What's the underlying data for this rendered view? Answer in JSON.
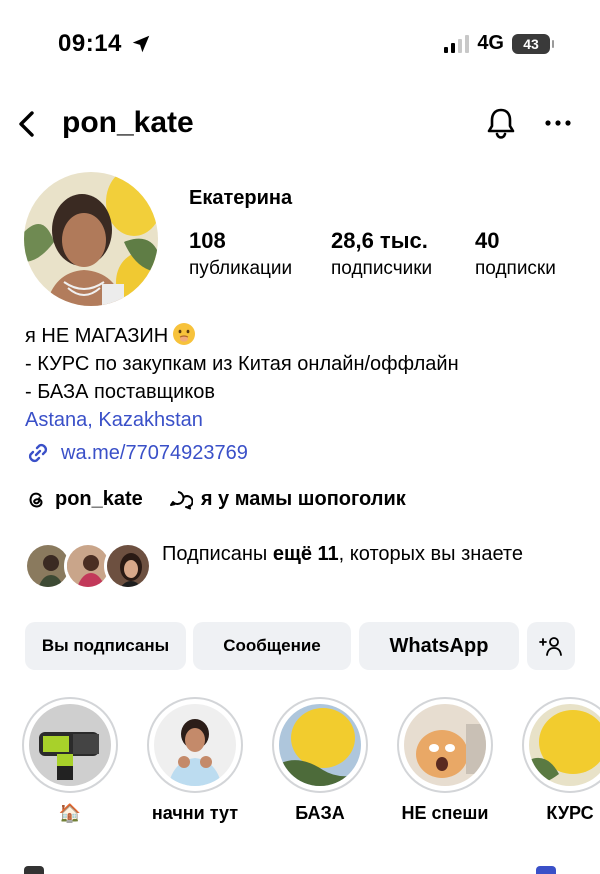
{
  "status_bar": {
    "time": "09:14",
    "network": "4G",
    "battery": "43"
  },
  "header": {
    "username": "pon_kate"
  },
  "profile": {
    "name": "Екатерина",
    "stats": [
      {
        "value": "108",
        "label": "публикации"
      },
      {
        "value": "28,6 тыс.",
        "label": "подписчики"
      },
      {
        "value": "40",
        "label": "подписки"
      }
    ],
    "bio": [
      "я НЕ МАГАЗИН",
      "- КУРС по закупкам из Китая онлайн/оффлайн",
      "- БАЗА поставщиков"
    ],
    "location": "Astana, Kazakhstan",
    "link": "wa.me/77074923769",
    "threads_handle": "pon_kate",
    "channel": "я у мамы шопоголик",
    "followed_by": {
      "prefix": "Подписаны",
      "count": "ещё 11",
      "suffix": ", которых вы знаете"
    }
  },
  "actions": {
    "following": "Вы подписаны",
    "message": "Сообщение",
    "whatsapp": "WhatsApp"
  },
  "highlights": [
    {
      "label": "🏠"
    },
    {
      "label": "начни тут"
    },
    {
      "label": "БАЗА"
    },
    {
      "label": "НЕ спеши"
    },
    {
      "label": "КУРС"
    }
  ],
  "colors": {
    "link_blue": "#3a50c8",
    "button_bg": "#eff1f4"
  }
}
